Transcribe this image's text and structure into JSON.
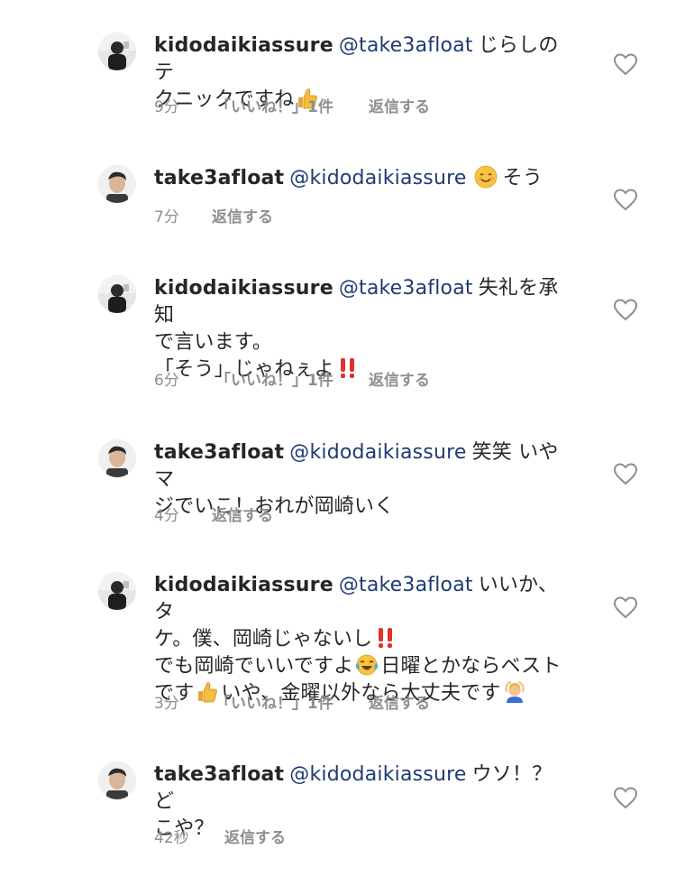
{
  "comments": [
    {
      "username": "kidodaikiassure",
      "mention": "@take3afloat",
      "line1": "じらしのテ",
      "line2": "クニックですね",
      "time": "9分",
      "likes": "「いいね！」1件",
      "reply": "返信する"
    },
    {
      "username": "take3afloat",
      "mention": "@kidodaikiassure",
      "line1": "そう",
      "time": "7分",
      "reply": "返信する"
    },
    {
      "username": "kidodaikiassure",
      "mention": "@take3afloat",
      "line1": "失礼を承知",
      "line2": "で言います。",
      "line3": "「そう」じゃねぇよ",
      "time": "6分",
      "likes": "「いいね！」1件",
      "reply": "返信する"
    },
    {
      "username": "take3afloat",
      "mention": "@kidodaikiassure",
      "line1": "笑笑 いやマ",
      "line2": "ジでいこ！おれが岡崎いく",
      "time": "4分",
      "reply": "返信する"
    },
    {
      "username": "kidodaikiassure",
      "mention": "@take3afloat",
      "line1": "いいか、タ",
      "line2": "ケ。僕、岡崎じゃないし",
      "line3a": "でも岡崎でいいですよ",
      "line3b": "日曜とかならベスト",
      "line4a": "です",
      "line4b": "いや、金曜以外なら大丈夫です",
      "time": "3分",
      "likes": "「いいね！」1件",
      "reply": "返信する"
    },
    {
      "username": "take3afloat",
      "mention": "@kidodaikiassure",
      "line1": "ウソ！？ ど",
      "line2": "こや？",
      "time": "42秒",
      "reply": "返信する"
    }
  ],
  "icons": {
    "like": "heart-outline-icon",
    "thumbs_up": "thumbs-up-emoji",
    "smile": "smiling-face-emoji",
    "exclamation": "double-exclamation-emoji",
    "laugh": "tears-of-joy-emoji",
    "ok_gesture": "person-ok-gesture-emoji"
  },
  "colors": {
    "mention": "#1f3b73",
    "meta": "#8e8e8e",
    "text": "#262626"
  }
}
